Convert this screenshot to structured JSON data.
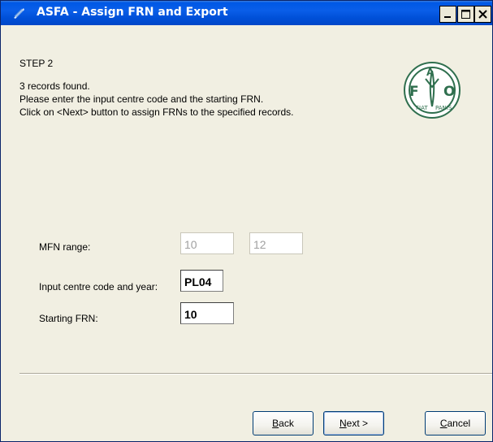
{
  "window": {
    "title": "ASFA - Assign FRN and Export"
  },
  "titlebar": {
    "min_label": "_",
    "max_label": "□",
    "close_label": "×"
  },
  "header": {
    "step": "STEP 2",
    "lines": [
      "3 records found.",
      "Please enter the input centre code and the starting FRN.",
      "Click on <Next> button to assign FRNs to the specified records."
    ]
  },
  "logo": {
    "top_text": "F A O",
    "bottom_text": "FIAT PANIS"
  },
  "form": {
    "mfn_label": "MFN range:",
    "mfn_from": "10",
    "mfn_to": "12",
    "centre_label": "Input centre code and year:",
    "centre_value": "PL04",
    "frn_label": "Starting FRN:",
    "frn_value": "10"
  },
  "buttons": {
    "back_mnemonic": "B",
    "back_rest": "ack",
    "next_mnemonic": "N",
    "next_rest": "ext >",
    "cancel_mnemonic": "C",
    "cancel_rest": "ancel"
  }
}
